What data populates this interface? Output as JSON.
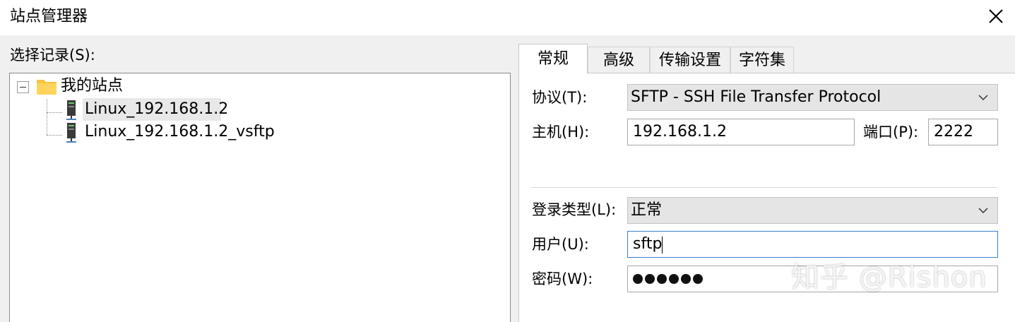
{
  "window": {
    "title": "站点管理器"
  },
  "left": {
    "label": "选择记录(S):",
    "tree": {
      "root": "我的站点",
      "items": [
        "Linux_192.168.1.2",
        "Linux_192.168.1.2_vsftp"
      ],
      "selected_index": 0
    }
  },
  "tabs": [
    {
      "label": "常规",
      "active": true
    },
    {
      "label": "高级",
      "active": false
    },
    {
      "label": "传输设置",
      "active": false
    },
    {
      "label": "字符集",
      "active": false
    }
  ],
  "form": {
    "protocol_label": "协议(T):",
    "protocol_value": "SFTP - SSH File Transfer Protocol",
    "host_label": "主机(H):",
    "host_value": "192.168.1.2",
    "port_label": "端口(P):",
    "port_value": "2222",
    "logon_label": "登录类型(L):",
    "logon_value": "正常",
    "user_label": "用户(U):",
    "user_value": "sftp",
    "password_label": "密码(W):",
    "password_length": 6
  },
  "watermark": "知乎 @Rishon",
  "colors": {
    "folder": "#f5c342",
    "focus_border": "#3b7fd1",
    "selection": "#e8e8e8"
  }
}
